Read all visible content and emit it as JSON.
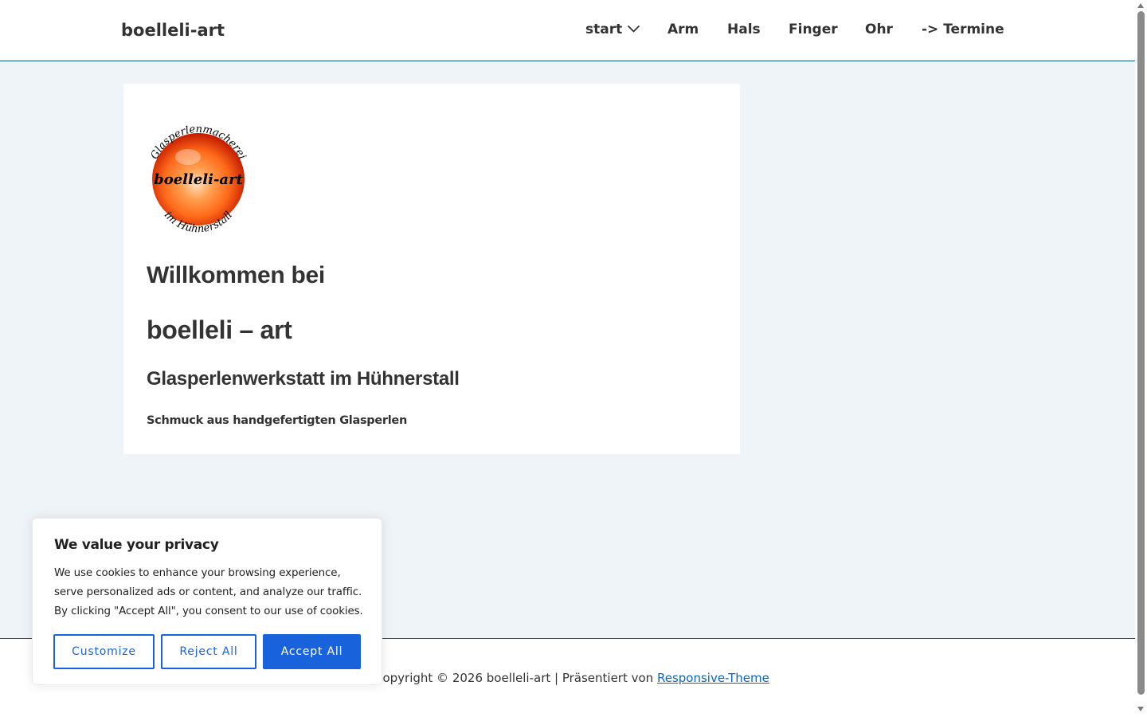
{
  "header": {
    "site_title": "boelleli-art",
    "nav": [
      {
        "label": "start"
      },
      {
        "label": "Arm"
      },
      {
        "label": "Hals"
      },
      {
        "label": "Finger"
      },
      {
        "label": "Ohr"
      },
      {
        "label": "-> Termine"
      }
    ]
  },
  "main": {
    "logo": {
      "top_text": "Glasperlenmacherei",
      "center_text": "boelleli-art",
      "bottom_text": "im Hühnerstall",
      "colors": {
        "outer": "#c21a00",
        "mid": "#ff6a1a",
        "highlight": "#ffe0c0"
      }
    },
    "heading_line1": "Willkommen bei",
    "heading_line2": "boelleli – art",
    "subheading": "Glasperlenwerkstatt im Hühnerstall",
    "tagline": "Schmuck aus handgefertigten Glasperlen"
  },
  "footer": {
    "copyright": "Copyright © 2026 boelleli-art | Präsentiert von ",
    "theme_link": "Responsive-Theme"
  },
  "cookie_banner": {
    "title": "We value your privacy",
    "text": "We use cookies to enhance your browsing experience, serve personalized ads or content, and analyze our traffic. By clicking \"Accept All\", you consent to our use of cookies.",
    "buttons": {
      "customize": "Customize",
      "reject": "Reject All",
      "accept": "Accept All"
    },
    "accent_color": "#1863dc"
  },
  "colors": {
    "page_background": "#eef4f8",
    "header_border": "#0a5a7a",
    "link": "#0a66c2"
  }
}
